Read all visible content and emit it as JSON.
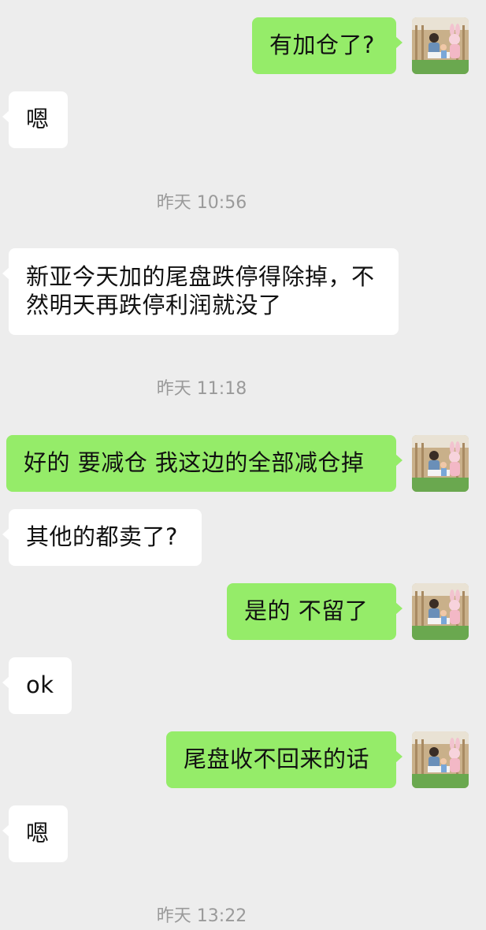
{
  "chat": {
    "messages": [
      {
        "side": "sent",
        "text": "有加仓了?"
      },
      {
        "side": "recv",
        "text": "嗯"
      },
      {
        "type": "time",
        "text": "昨天 10:56"
      },
      {
        "side": "recv",
        "text": "新亚今天加的尾盘跌停得除掉，不然明天再跌停利润就没了"
      },
      {
        "type": "time",
        "text": "昨天 11:18"
      },
      {
        "side": "sent",
        "text": "好的  要减仓  我这边的全部减仓掉"
      },
      {
        "side": "recv",
        "text": "其他的都卖了?"
      },
      {
        "side": "sent",
        "text": "是的  不留了"
      },
      {
        "side": "recv",
        "text": "ok"
      },
      {
        "side": "sent",
        "text": "尾盘收不回来的话"
      },
      {
        "side": "recv",
        "text": "嗯"
      },
      {
        "type": "time",
        "text": "昨天 13:22"
      }
    ]
  },
  "colors": {
    "background": "#ededed",
    "sent_bubble": "#95ec69",
    "recv_bubble": "#ffffff",
    "timestamp_text": "#9a9a9a"
  },
  "icons": {
    "avatar": "user-avatar-photo"
  }
}
